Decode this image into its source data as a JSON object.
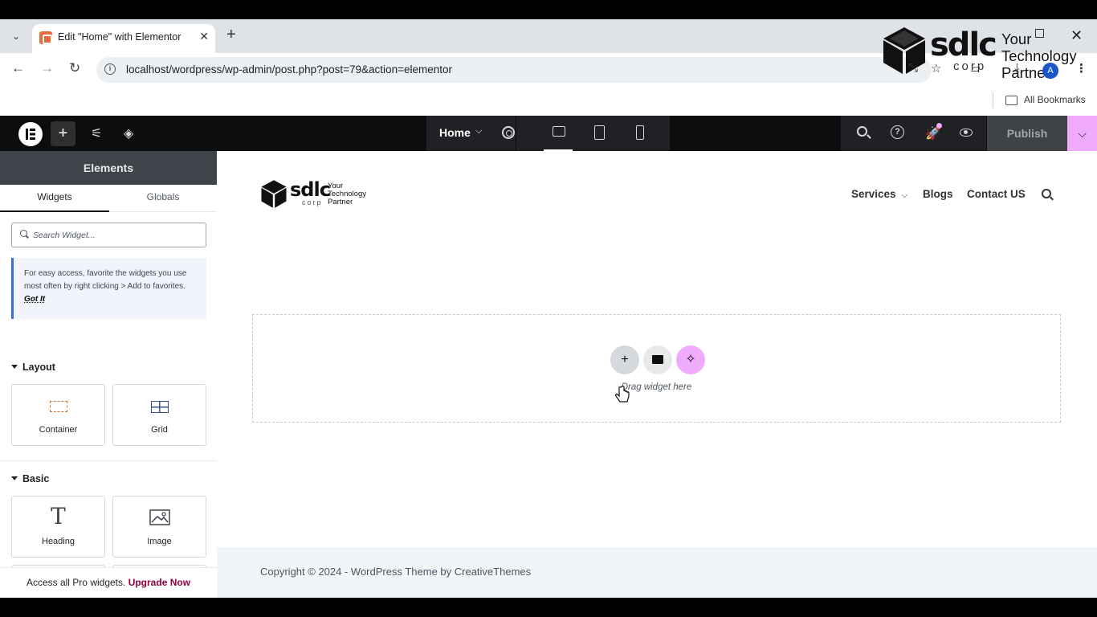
{
  "browser": {
    "tab_title": "Edit \"Home\" with Elementor",
    "url": "localhost/wordpress/wp-admin/post.php?post=79&action=elementor",
    "bookmarks_label": "All Bookmarks",
    "avatar_letter": "A"
  },
  "watermark": {
    "brand": "sdlc",
    "corp": "corp",
    "tagline": "Your Technology Partner"
  },
  "editor_top": {
    "page_name": "Home",
    "publish_label": "Publish"
  },
  "panel": {
    "title": "Elements",
    "tabs": [
      "Widgets",
      "Globals"
    ],
    "search_placeholder": "Search Widget...",
    "tip_text": "For easy access, favorite the widgets you use most often by right clicking > Add to favorites.",
    "tip_link": "Got It",
    "categories": [
      {
        "title": "Layout",
        "widgets": [
          "Container",
          "Grid"
        ]
      },
      {
        "title": "Basic",
        "widgets": [
          "Heading",
          "Image"
        ]
      }
    ],
    "upgrade_text": "Access all Pro widgets.",
    "upgrade_link": "Upgrade Now"
  },
  "site": {
    "logo_brand": "sdlc",
    "logo_corp": "corp",
    "logo_tagline_1": "Your",
    "logo_tagline_2": "Technology",
    "logo_tagline_3": "Partner",
    "nav": [
      "Services",
      "Blogs",
      "Contact US"
    ],
    "drop_hint": "Drag widget here",
    "footer": "Copyright © 2024 - WordPress Theme by CreativeThemes"
  },
  "colors": {
    "accent_pink": "#f0abfc",
    "upgrade_link": "#93003f",
    "editor_bar": "#0c0d0e"
  }
}
